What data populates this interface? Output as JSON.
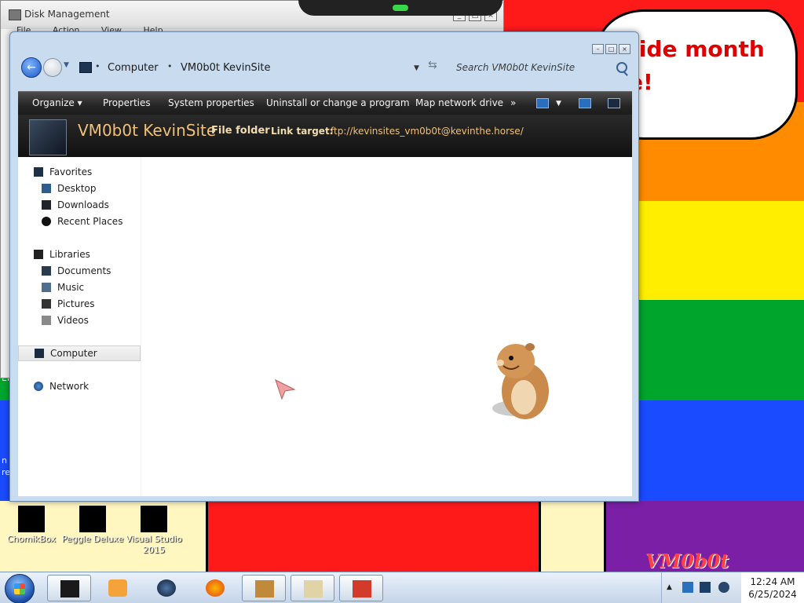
{
  "desktop": {
    "bubble_text": "ride month\ne!",
    "corner_logo": "VM0b0t",
    "side_fragments": [
      "Er",
      "n",
      "re"
    ],
    "icons": [
      {
        "label": "ChomikBox"
      },
      {
        "label": "Peggle Deluxe"
      },
      {
        "label": "Visual Studio 2015"
      }
    ]
  },
  "background_window": {
    "title": "Disk Management",
    "menu": [
      "File",
      "Action",
      "View",
      "Help"
    ]
  },
  "explorer": {
    "address": {
      "crumbs": [
        "Computer",
        "VM0b0t KevinSite"
      ]
    },
    "search_placeholder": "Search VM0b0t KevinSite",
    "toolbar": {
      "organize": "Organize",
      "properties": "Properties",
      "system_properties": "System properties",
      "uninstall": "Uninstall or change a program",
      "map_drive": "Map network drive",
      "more": "»"
    },
    "details": {
      "title": "VM0b0t KevinSite",
      "type": "File folder",
      "link_label": "Link target:",
      "link_value": "ftp://kevinsites_vm0b0t@kevinthe.horse/"
    },
    "nav": {
      "favorites": "Favorites",
      "desktop": "Desktop",
      "downloads": "Downloads",
      "recent": "Recent Places",
      "libraries": "Libraries",
      "documents": "Documents",
      "music": "Music",
      "pictures": "Pictures",
      "videos": "Videos",
      "computer": "Computer",
      "network": "Network"
    }
  },
  "taskbar": {
    "clock_time": "12:24 AM",
    "clock_date": "6/25/2024"
  }
}
